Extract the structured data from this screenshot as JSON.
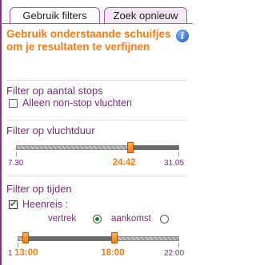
{
  "tabs": {
    "active_label": "Gebruik filters",
    "inactive_label": "Zoek opnieuw"
  },
  "intro_text": "Gebruik onderstaande schuifjes om je resultaten te verfijnen",
  "info_icon_glyph": "i",
  "stops": {
    "title": "Filter op aantal stops",
    "checkbox_label": "Alleen non-stop vluchten",
    "checked": false
  },
  "duration": {
    "title": "Filter op vluchtduur",
    "min_label": "7.30",
    "max_label": "31.05",
    "selected_value": "24.42",
    "fraction": 0.7
  },
  "times": {
    "title": "Filter op tijden",
    "outbound_label": "Heenreis :",
    "outbound_checked": true,
    "radio_departure": "vertrek",
    "radio_arrival": "aankomst",
    "selected_radio": "vertrek",
    "min_label": "1",
    "max_label": "22:00",
    "left_value": "13:00",
    "right_value": "18:00",
    "left_fraction": 0.05,
    "right_fraction": 0.6
  },
  "colors": {
    "accent": "#f07d1a",
    "purple": "#7a2b7a",
    "tab_border": "#b44fb0"
  }
}
